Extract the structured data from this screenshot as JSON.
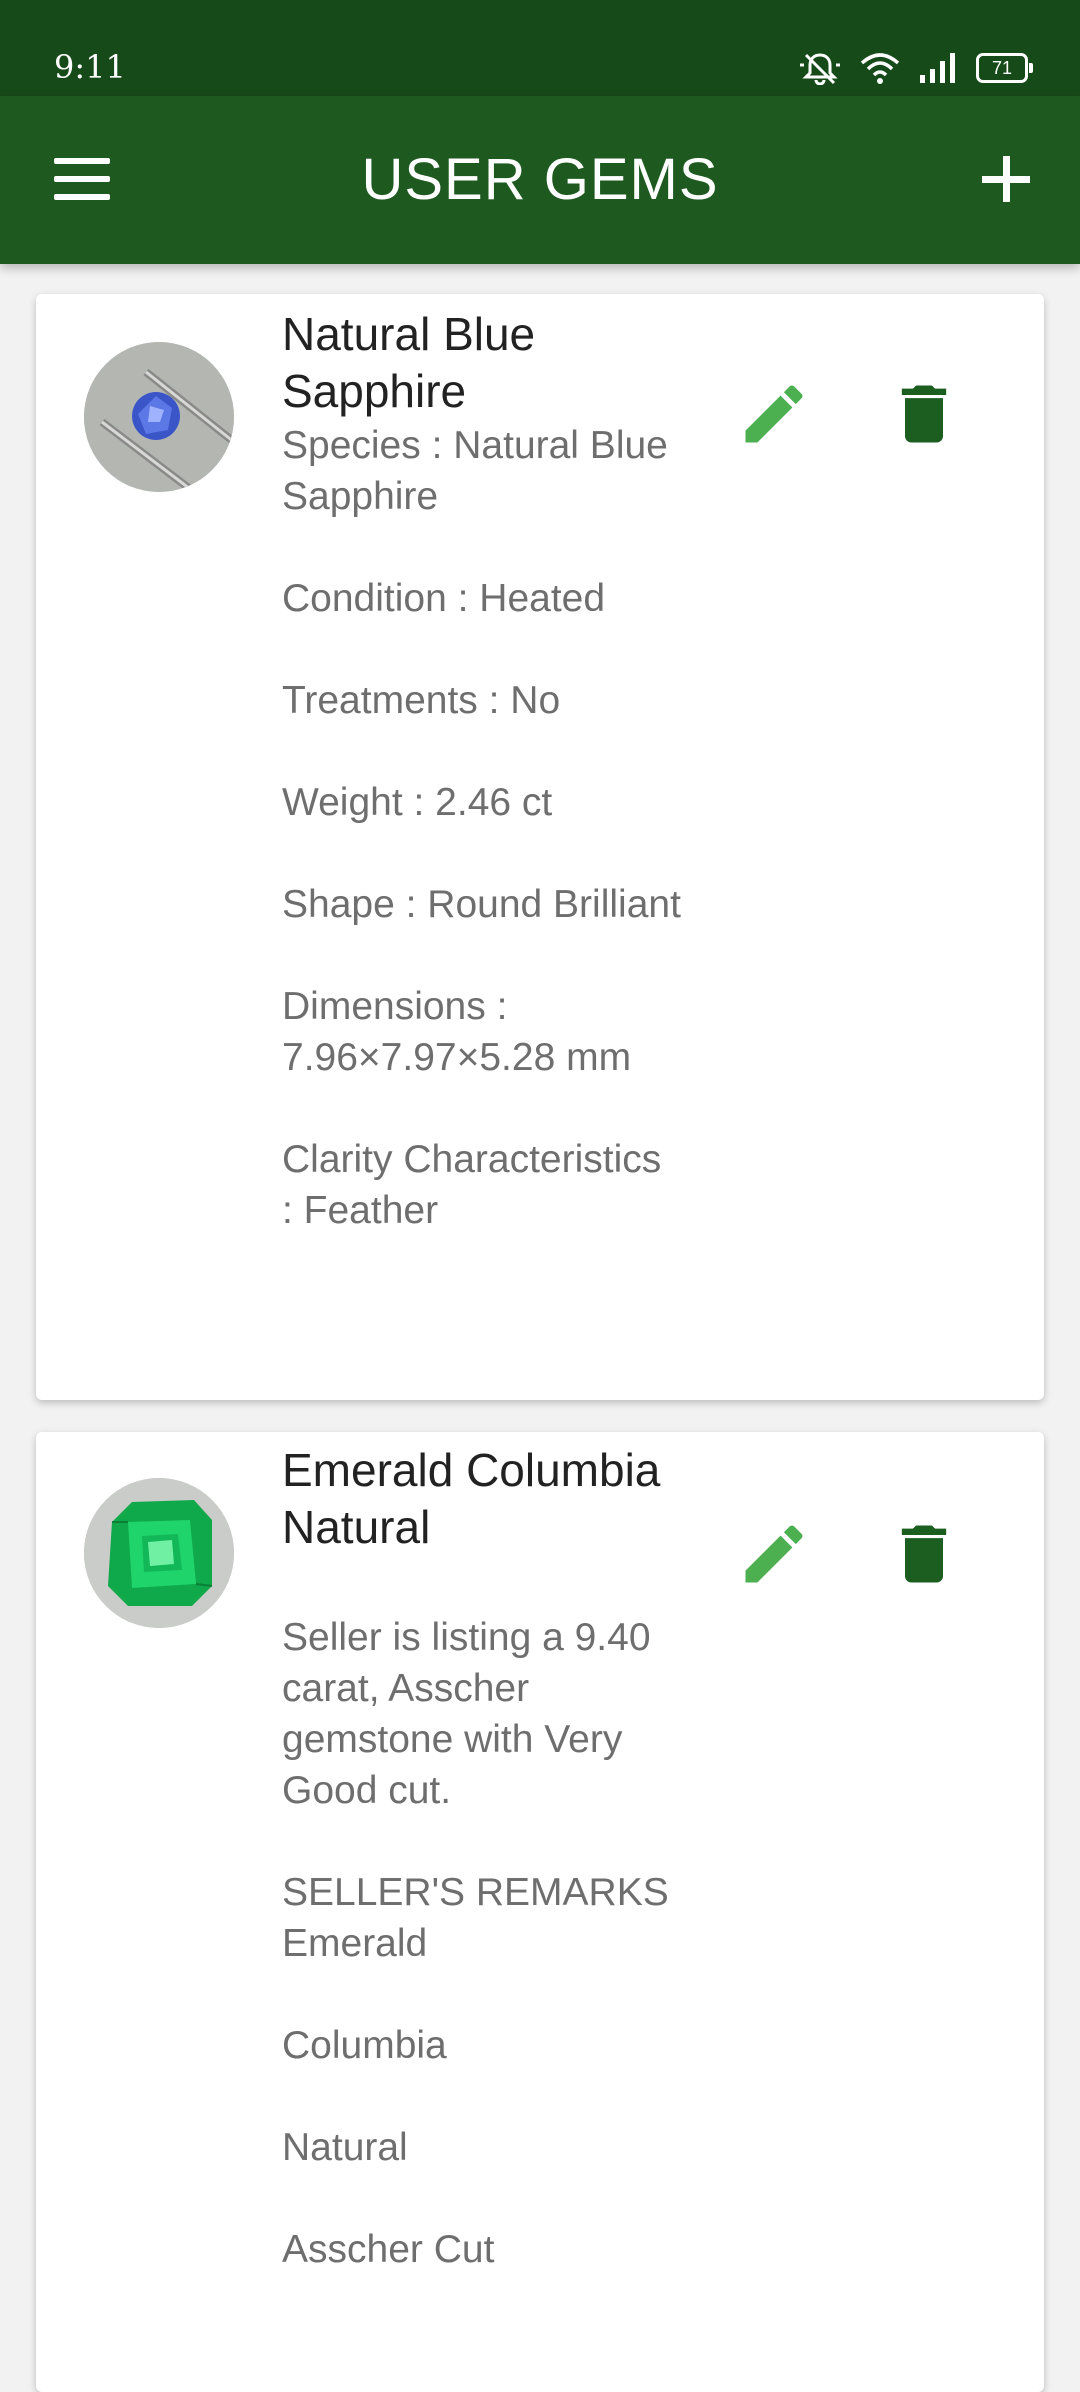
{
  "status_bar": {
    "time": "9:11",
    "battery": "71",
    "icons": [
      "mute-icon",
      "wifi-icon",
      "signal-icon",
      "battery-icon"
    ]
  },
  "app_bar": {
    "title": "USER GEMS",
    "menu_icon": "hamburger-icon",
    "add_icon": "plus-icon"
  },
  "colors": {
    "status_bar": "#174a19",
    "app_bar": "#1e5a20",
    "edit_icon": "#4caf50",
    "delete_icon": "#1b5e20"
  },
  "gems": [
    {
      "title": "Natural Blue Sapphire",
      "description": "Species : Natural Blue Sapphire\n\nCondition : Heated\n\nTreatments : No\n\nWeight : 2.46 ct\n\nShape : Round Brilliant\n\nDimensions : 7.96×7.97×5.28 mm\n\nClarity Characteristics : Feather",
      "edit_icon": "pencil-icon",
      "delete_icon": "trash-icon"
    },
    {
      "title": "Emerald Columbia Natural",
      "description": "Seller is listing a 9.40 carat, Asscher gemstone with Very Good cut.\n\nSELLER'S REMARKS\nEmerald\n\nColumbia\n\nNatural\n\nAsscher Cut",
      "edit_icon": "pencil-icon",
      "delete_icon": "trash-icon"
    }
  ]
}
